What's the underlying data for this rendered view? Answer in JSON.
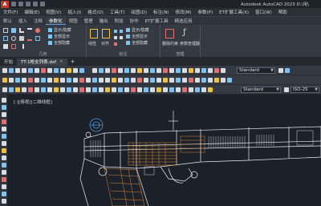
{
  "app": {
    "logo_text": "A",
    "title": "Autodesk AutoCAD 2023   D:\\用\\",
    "logo_color": "#c0392b"
  },
  "menubar": {
    "items": [
      "文件(F)",
      "编辑(E)",
      "视图(V)",
      "插入(I)",
      "格式(O)",
      "工具(T)",
      "绘图(D)",
      "标注(N)",
      "修改(M)",
      "参数(P)",
      "ET扩展工具(X)",
      "窗口(W)",
      "帮助"
    ]
  },
  "ribbon_tabs": {
    "items": [
      "默认",
      "插入",
      "注释",
      "参数化",
      "视图",
      "管理",
      "输出",
      "附加",
      "协作",
      "ET扩展工具",
      "精选应用"
    ],
    "active_index": 3
  },
  "ribbon": {
    "geometry_panel": {
      "title": "几何"
    },
    "show_hide": {
      "items": [
        "显示/隐藏",
        "全部显示",
        "全部隐藏"
      ]
    },
    "dim_panel": {
      "title": "标注",
      "big1": "线性",
      "big2": "对齐"
    },
    "show_hide2": {
      "items": [
        "显示/隐藏",
        "全部显示",
        "全部隐藏"
      ]
    },
    "manage_panel": {
      "title": "管理",
      "big1": "删除约束",
      "big2": "参数管理器"
    }
  },
  "doc_tabs": {
    "items": [
      {
        "label": "开始",
        "active": false
      },
      {
        "label": "TT-1枪支列表.dxf",
        "active": true
      }
    ],
    "close_glyph": "×",
    "plus_glyph": "+"
  },
  "toolbar": {
    "text_style": "Standard",
    "dim_style": "Standard",
    "standard2": "Standard",
    "iso": "ISO-25"
  },
  "canvas": {
    "viewport_label": "[-][俯视][二维线框]",
    "background": "#1c2028",
    "drawing_colors": {
      "frame": "#e9edf2",
      "hatch": "#d98a3a",
      "spring": "#cdd2d8",
      "circle": "#4fa3e8"
    }
  }
}
